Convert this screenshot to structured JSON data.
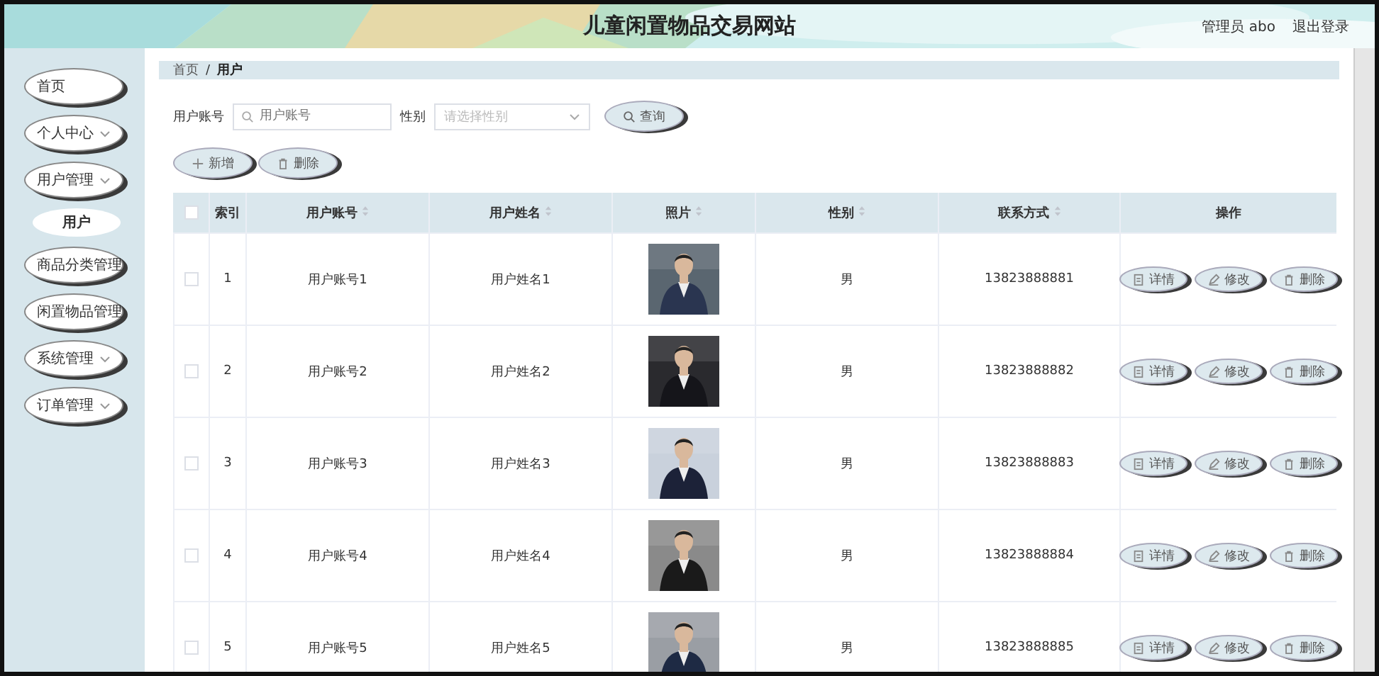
{
  "header": {
    "title": "儿童闲置物品交易网站",
    "user": "管理员 abo",
    "logout": "退出登录"
  },
  "sidebar": {
    "items": [
      {
        "label": "首页",
        "expandable": false
      },
      {
        "label": "个人中心",
        "expandable": true
      },
      {
        "label": "用户管理",
        "expandable": true,
        "children": [
          {
            "label": "用户",
            "selected": true
          }
        ]
      },
      {
        "label": "商品分类管理",
        "expandable": false
      },
      {
        "label": "闲置物品管理",
        "expandable": false
      },
      {
        "label": "系统管理",
        "expandable": true
      },
      {
        "label": "订单管理",
        "expandable": true
      }
    ]
  },
  "breadcrumb": {
    "items": [
      "首页",
      "用户"
    ],
    "separator": "/"
  },
  "search": {
    "account_label": "用户账号",
    "account_placeholder": "用户账号",
    "gender_label": "性别",
    "gender_placeholder": "请选择性别",
    "button": "查询"
  },
  "actions": {
    "add": "新增",
    "delete": "删除"
  },
  "table": {
    "select_all_checked": false,
    "columns": [
      {
        "label": "索引",
        "sortable": false
      },
      {
        "label": "用户账号",
        "sortable": true
      },
      {
        "label": "用户姓名",
        "sortable": true
      },
      {
        "label": "照片",
        "sortable": true
      },
      {
        "label": "性别",
        "sortable": true
      },
      {
        "label": "联系方式",
        "sortable": true
      },
      {
        "label": "操作",
        "sortable": false
      }
    ],
    "rows": [
      {
        "checked": false,
        "index": "1",
        "account": "用户账号1",
        "name": "用户姓名1",
        "gender": "男",
        "phone": "13823888881",
        "buttons": [
          {
            "kind": "details",
            "label": "详情"
          },
          {
            "kind": "edit",
            "label": "修改"
          },
          {
            "kind": "delete",
            "label": "删除"
          }
        ]
      },
      {
        "checked": false,
        "index": "2",
        "account": "用户账号2",
        "name": "用户姓名2",
        "gender": "男",
        "phone": "13823888882",
        "buttons": [
          {
            "kind": "details",
            "label": "详情"
          },
          {
            "kind": "edit",
            "label": "修改"
          },
          {
            "kind": "delete",
            "label": "删除"
          }
        ]
      },
      {
        "checked": false,
        "index": "3",
        "account": "用户账号3",
        "name": "用户姓名3",
        "gender": "男",
        "phone": "13823888883",
        "buttons": [
          {
            "kind": "details",
            "label": "详情"
          },
          {
            "kind": "edit",
            "label": "修改"
          },
          {
            "kind": "delete",
            "label": "删除"
          }
        ]
      },
      {
        "checked": false,
        "index": "4",
        "account": "用户账号4",
        "name": "用户姓名4",
        "gender": "男",
        "phone": "13823888884",
        "buttons": [
          {
            "kind": "details",
            "label": "详情"
          },
          {
            "kind": "edit",
            "label": "修改"
          },
          {
            "kind": "delete",
            "label": "删除"
          }
        ]
      },
      {
        "checked": false,
        "index": "5",
        "account": "用户账号5",
        "name": "用户姓名5",
        "gender": "男",
        "phone": "13823888885",
        "buttons": [
          {
            "kind": "details",
            "label": "详情"
          },
          {
            "kind": "edit",
            "label": "修改"
          },
          {
            "kind": "delete",
            "label": "删除"
          }
        ]
      }
    ]
  }
}
